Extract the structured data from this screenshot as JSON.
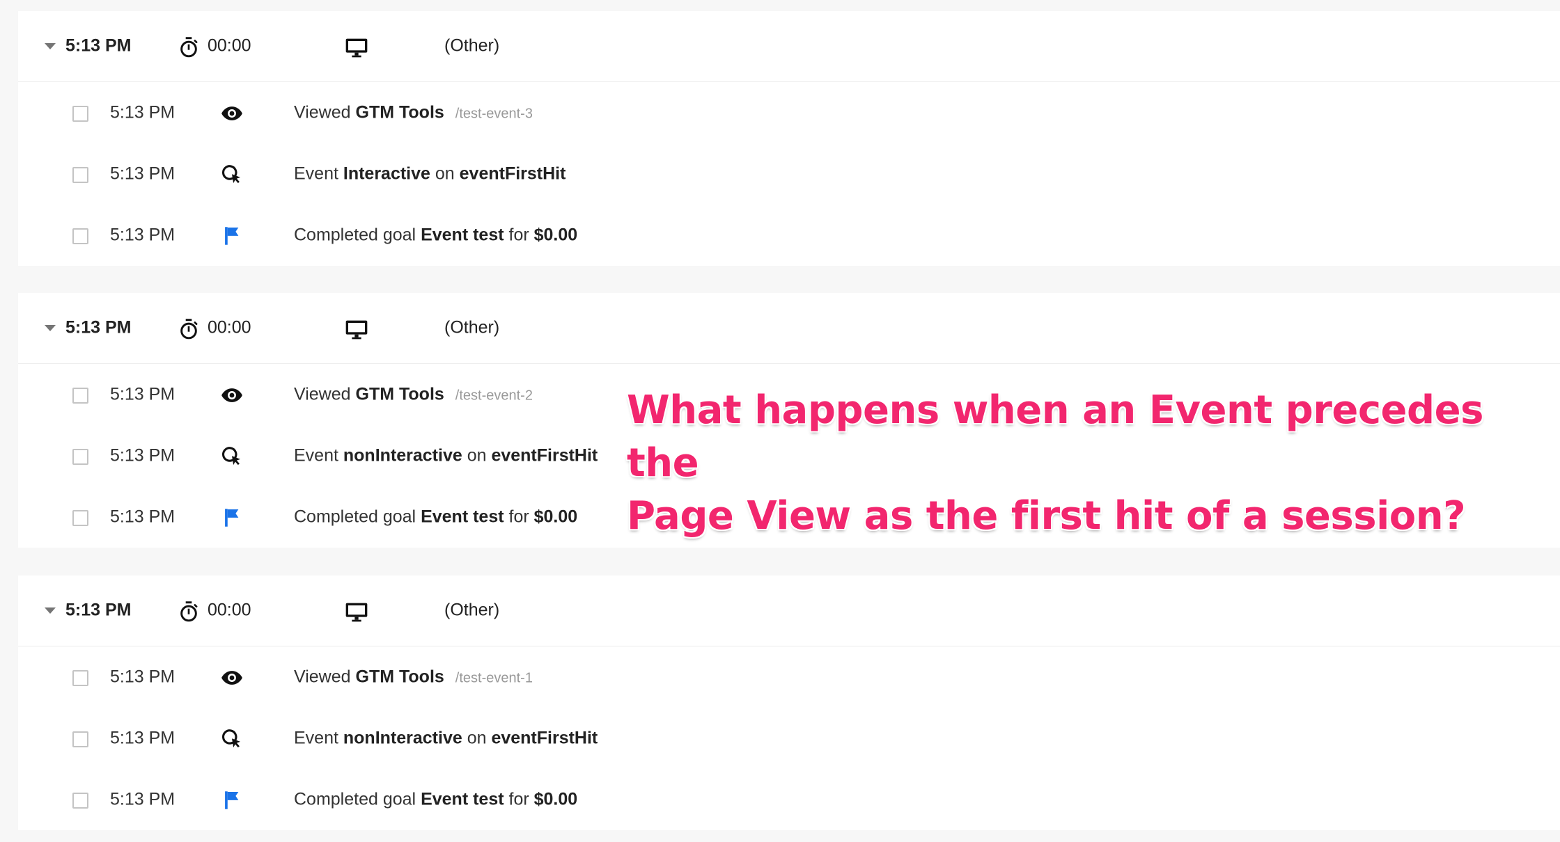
{
  "sessions": [
    {
      "time": "5:13 PM",
      "duration": "00:00",
      "source": "(Other)",
      "hits": [
        {
          "time": "5:13 PM",
          "icon": "eye-icon",
          "parts": [
            {
              "t": "Viewed ",
              "b": false
            },
            {
              "t": "GTM Tools",
              "b": true
            }
          ],
          "path": "/test-event-3"
        },
        {
          "time": "5:13 PM",
          "icon": "cursor-click-icon",
          "parts": [
            {
              "t": "Event ",
              "b": false
            },
            {
              "t": "Interactive",
              "b": true
            },
            {
              "t": " on ",
              "b": false
            },
            {
              "t": "eventFirstHit",
              "b": true
            }
          ]
        },
        {
          "time": "5:13 PM",
          "icon": "flag-icon",
          "parts": [
            {
              "t": "Completed goal ",
              "b": false
            },
            {
              "t": "Event test",
              "b": true
            },
            {
              "t": " for ",
              "b": false
            },
            {
              "t": "$0.00",
              "b": true
            }
          ]
        }
      ]
    },
    {
      "time": "5:13 PM",
      "duration": "00:00",
      "source": "(Other)",
      "hits": [
        {
          "time": "5:13 PM",
          "icon": "eye-icon",
          "parts": [
            {
              "t": "Viewed ",
              "b": false
            },
            {
              "t": "GTM Tools",
              "b": true
            }
          ],
          "path": "/test-event-2"
        },
        {
          "time": "5:13 PM",
          "icon": "cursor-click-icon",
          "parts": [
            {
              "t": "Event ",
              "b": false
            },
            {
              "t": "nonInteractive",
              "b": true
            },
            {
              "t": " on ",
              "b": false
            },
            {
              "t": "eventFirstHit",
              "b": true
            }
          ]
        },
        {
          "time": "5:13 PM",
          "icon": "flag-icon",
          "parts": [
            {
              "t": "Completed goal ",
              "b": false
            },
            {
              "t": "Event test",
              "b": true
            },
            {
              "t": " for ",
              "b": false
            },
            {
              "t": "$0.00",
              "b": true
            }
          ]
        }
      ]
    },
    {
      "time": "5:13 PM",
      "duration": "00:00",
      "source": "(Other)",
      "hits": [
        {
          "time": "5:13 PM",
          "icon": "eye-icon",
          "parts": [
            {
              "t": "Viewed ",
              "b": false
            },
            {
              "t": "GTM Tools",
              "b": true
            }
          ],
          "path": "/test-event-1"
        },
        {
          "time": "5:13 PM",
          "icon": "cursor-click-icon",
          "parts": [
            {
              "t": "Event ",
              "b": false
            },
            {
              "t": "nonInteractive",
              "b": true
            },
            {
              "t": " on ",
              "b": false
            },
            {
              "t": "eventFirstHit",
              "b": true
            }
          ]
        },
        {
          "time": "5:13 PM",
          "icon": "flag-icon",
          "parts": [
            {
              "t": "Completed goal ",
              "b": false
            },
            {
              "t": "Event test",
              "b": true
            },
            {
              "t": " for ",
              "b": false
            },
            {
              "t": "$0.00",
              "b": true
            }
          ]
        }
      ]
    }
  ],
  "overlay": {
    "line1": "What happens when an Event precedes the",
    "line2": "Page View as the first hit of a session?"
  },
  "colors": {
    "flag": "#1a73e8",
    "overlay_text": "#f2266e"
  }
}
